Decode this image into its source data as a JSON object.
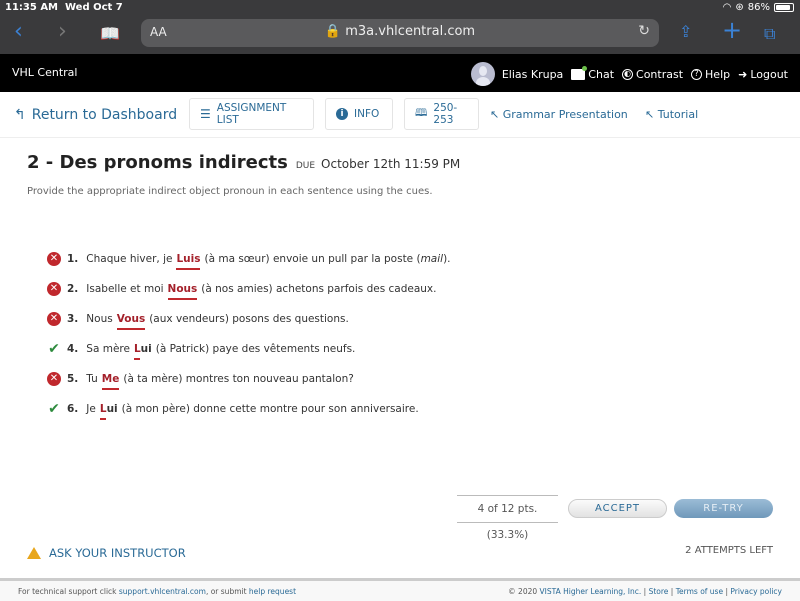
{
  "status_bar": {
    "time": "11:35 AM",
    "date": "Wed Oct 7",
    "battery": "86%"
  },
  "browser": {
    "text_size": "AA",
    "url": "m3a.vhlcentral.com"
  },
  "header": {
    "brand": "VHL Central",
    "user": "Elias Krupa",
    "chat": "Chat",
    "contrast": "Contrast",
    "help": "Help",
    "logout": "Logout"
  },
  "toolbar": {
    "return": "Return to Dashboard",
    "assignment_list": "ASSIGNMENT LIST",
    "info": "INFO",
    "pages": "250-253",
    "grammar": "Grammar Presentation",
    "tutorial": "Tutorial"
  },
  "assignment": {
    "title": "2 - Des pronoms indirects",
    "due_label": "DUE",
    "due_date": "October 12th 11:59 PM",
    "instructions": "Provide the appropriate indirect object pronoun in each sentence using the cues."
  },
  "questions": [
    {
      "num": "1.",
      "status": "wrong",
      "before": "Chaque hiver, je",
      "answer": "Luis",
      "after": "(à ma sœur) envoie un pull par la poste (",
      "italic": "mail",
      "end": ")."
    },
    {
      "num": "2.",
      "status": "wrong",
      "before": "Isabelle et moi",
      "answer": "Nous",
      "after": "(à nos amies) achetons parfois des cadeaux.",
      "italic": "",
      "end": ""
    },
    {
      "num": "3.",
      "status": "wrong",
      "before": "Nous",
      "answer": "Vous",
      "after": "(aux vendeurs) posons des questions.",
      "italic": "",
      "end": ""
    },
    {
      "num": "4.",
      "status": "correct",
      "before": "Sa mère",
      "answer_first": "L",
      "answer_rest": "ui",
      "after": "(à Patrick) paye des vêtements neufs.",
      "italic": "",
      "end": ""
    },
    {
      "num": "5.",
      "status": "wrong",
      "before": "Tu",
      "answer": "Me",
      "after": "(à ta mère) montres ton nouveau pantalon?",
      "italic": "",
      "end": ""
    },
    {
      "num": "6.",
      "status": "correct",
      "before": "Je",
      "answer_first": "L",
      "answer_rest": "ui",
      "after": "(à mon père) donne cette montre pour son anniversaire.",
      "italic": "",
      "end": ""
    }
  ],
  "score": {
    "text": "4 of 12 pts. (33.3%)",
    "accept": "ACCEPT",
    "retry": "RE-TRY",
    "attempts": "2 ATTEMPTS LEFT"
  },
  "ask": "ASK YOUR INSTRUCTOR",
  "footer": {
    "support_prefix": "For technical support click",
    "support_link": "support.vhlcentral.com",
    "support_mid": ", or submit",
    "help_link": "help request",
    "copyright": "© 2020",
    "company": "VISTA Higher Learning, Inc.",
    "store": "Store",
    "terms": "Terms of use",
    "privacy": "Privacy policy"
  }
}
